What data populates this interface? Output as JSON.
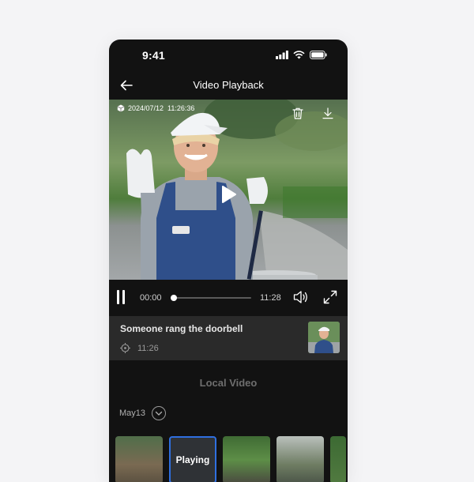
{
  "status_bar": {
    "time": "9:41",
    "icons": [
      "signal-icon",
      "wifi-icon",
      "battery-icon"
    ]
  },
  "header": {
    "title": "Video Playback",
    "back_icon": "arrow-left-icon"
  },
  "video": {
    "timestamp": "2024/07/12  11:26:36",
    "actions": [
      "trash-icon",
      "download-icon"
    ],
    "play_icon": "play-icon"
  },
  "controls": {
    "current_time": "00:00",
    "total_time": "11:28",
    "progress": 0.0
  },
  "event": {
    "title": "Someone rang the doorbell",
    "time": "11:26",
    "icon": "target-icon"
  },
  "local_video": {
    "title": "Local Video",
    "date": "May13",
    "thumbnails": [
      {
        "label": ""
      },
      {
        "label": "Playing"
      },
      {
        "label": ""
      },
      {
        "label": ""
      },
      {
        "label": ""
      }
    ]
  },
  "colors": {
    "background": "#121212",
    "card": "#2a2a2a",
    "accent": "#2f6fe0"
  }
}
